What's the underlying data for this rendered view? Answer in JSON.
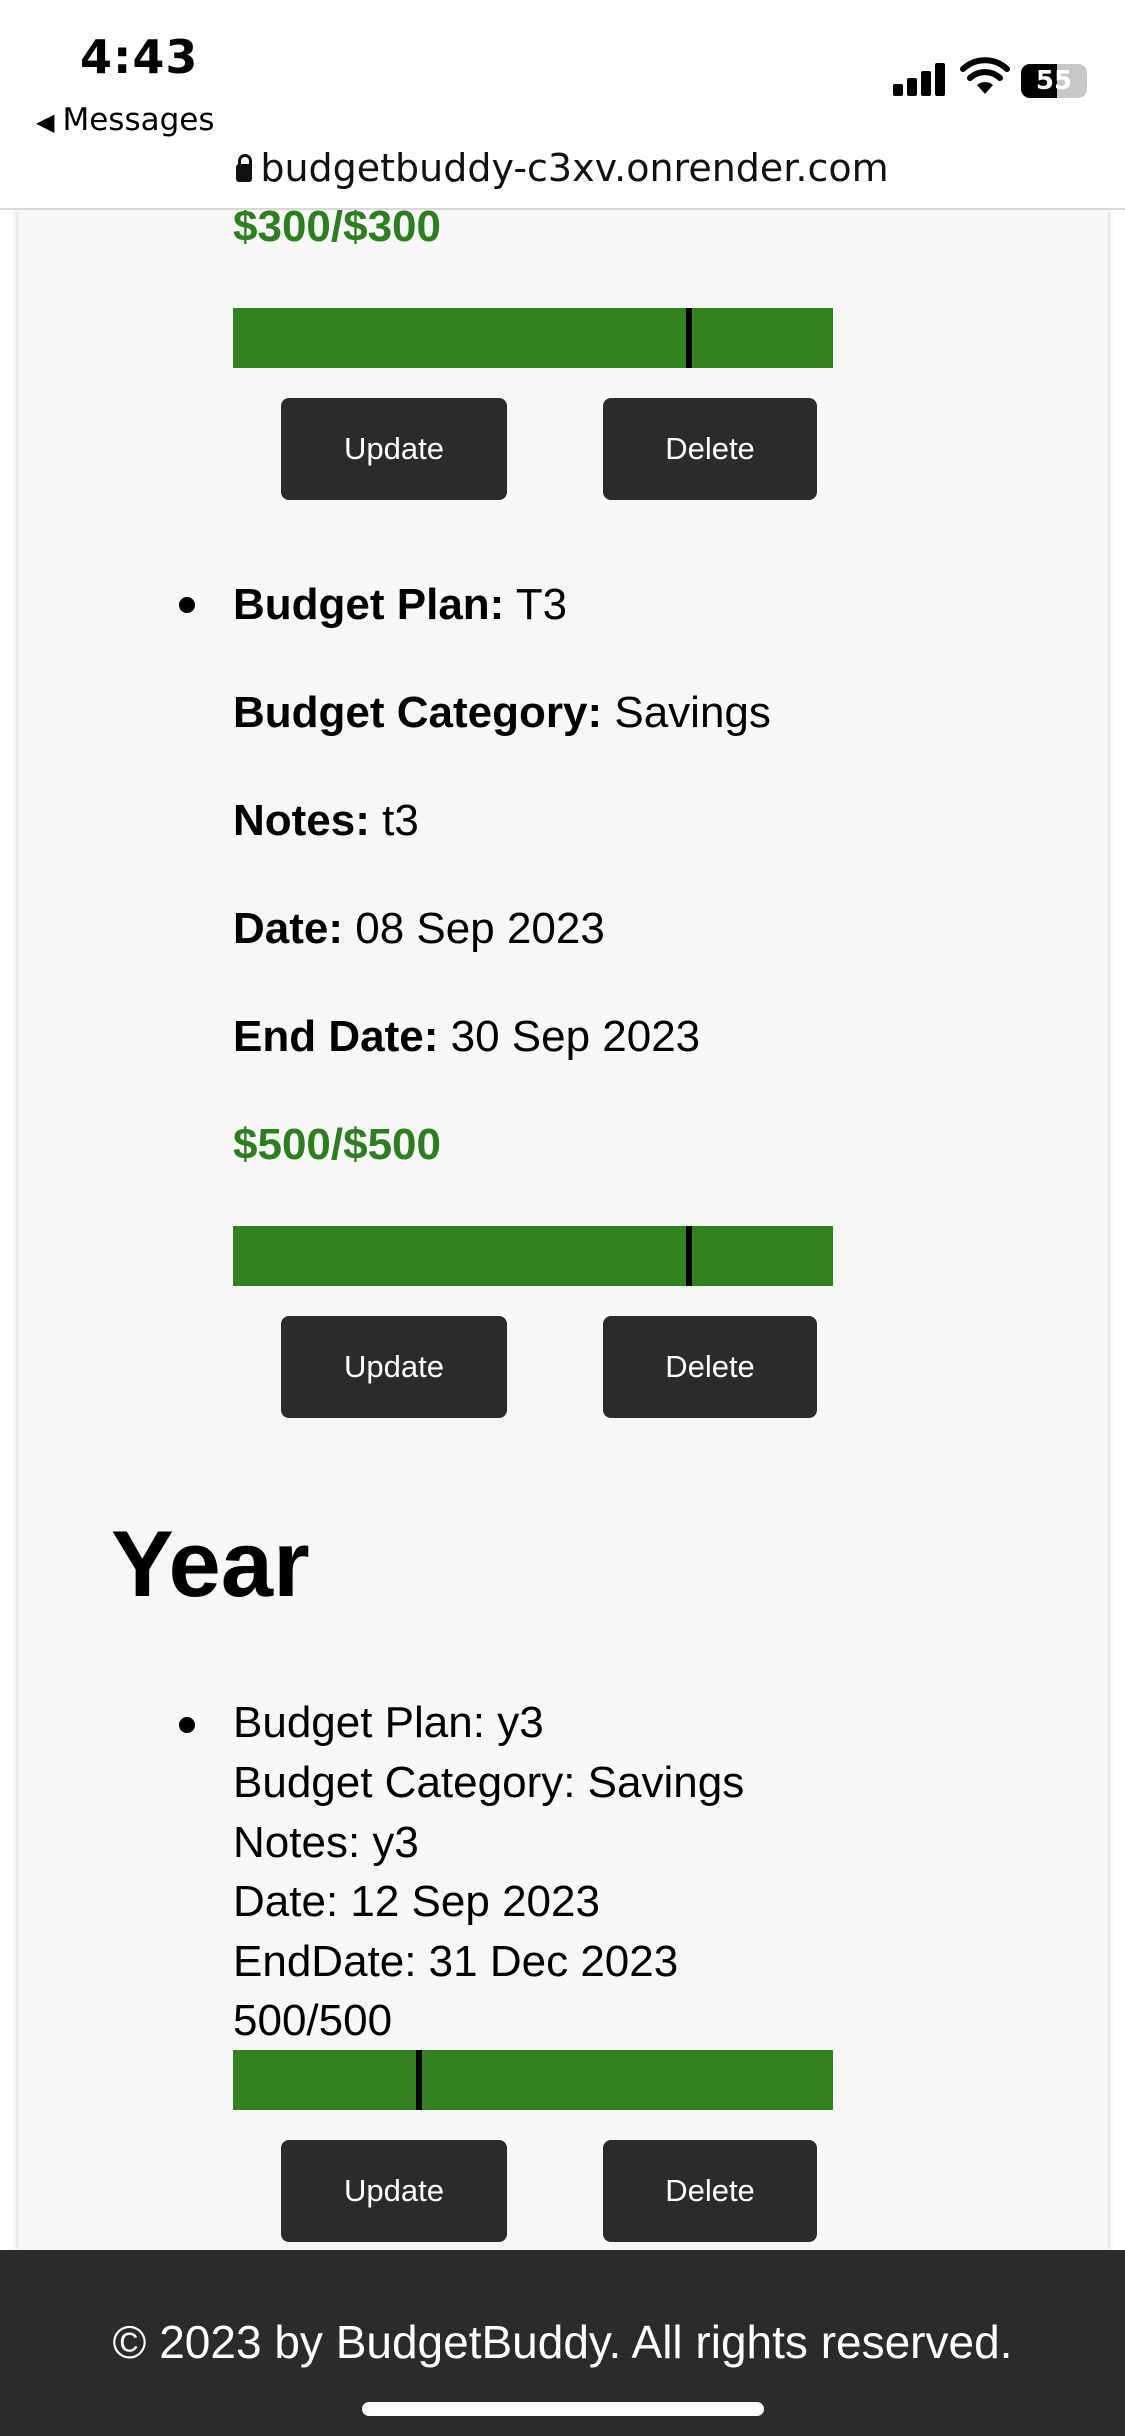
{
  "status_bar": {
    "time": "4:43",
    "back_label": "Messages",
    "battery": "55",
    "url": "budgetbuddy-c3xv.onrender.com"
  },
  "colors": {
    "accent_green": "#2e7d22",
    "bar_green": "#33821f",
    "button_bg": "#2b2b2b",
    "footer_bg": "#2b2b2b"
  },
  "plans": [
    {
      "amount": "$300/$300",
      "progress": 0.76,
      "update_label": "Update",
      "delete_label": "Delete"
    },
    {
      "plan_label": "Budget Plan:",
      "plan_value": "T3",
      "category_label": "Budget Category:",
      "category_value": "Savings",
      "notes_label": "Notes:",
      "notes_value": "t3",
      "date_label": "Date:",
      "date_value": "08 Sep 2023",
      "end_label": "End Date:",
      "end_value": "30 Sep 2023",
      "amount": "$500/$500",
      "progress": 0.76,
      "update_label": "Update",
      "delete_label": "Delete"
    }
  ],
  "year": {
    "heading": "Year",
    "item": {
      "plan": "Budget Plan: y3",
      "category": "Budget Category: Savings",
      "notes": "Notes: y3",
      "date": "Date: 12 Sep 2023",
      "end": "EndDate: 31 Dec 2023",
      "amount": "500/500",
      "progress": 0.31,
      "update_label": "Update",
      "delete_label": "Delete"
    }
  },
  "footer": {
    "text": "© 2023 by BudgetBuddy. All rights reserved."
  }
}
